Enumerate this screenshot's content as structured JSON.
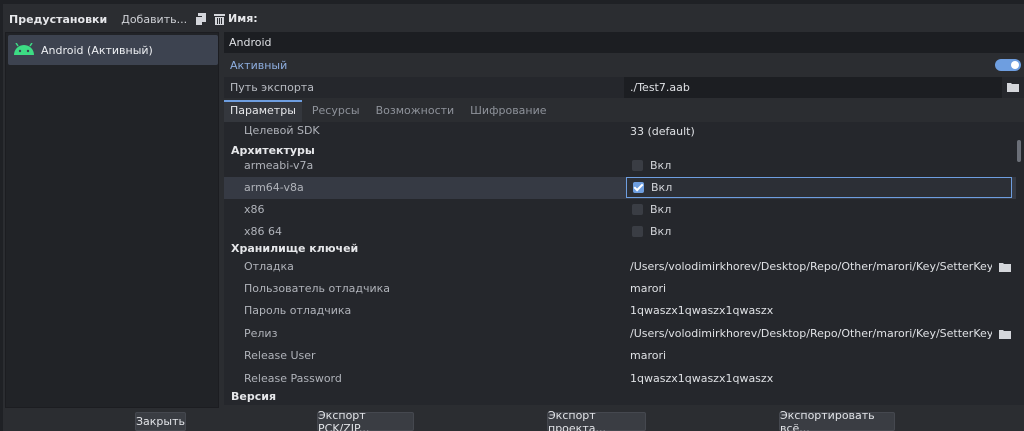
{
  "left_panel": {
    "title": "Предустановки",
    "add_label": "Добавить...",
    "presets": [
      {
        "label": "Android (Активный)",
        "icon": "android-icon"
      }
    ]
  },
  "header": {
    "name_label": "Имя:",
    "name_value": "Android",
    "active_label": "Активный",
    "active_on": true,
    "export_path_label": "Путь экспорта",
    "export_path_value": "./Test7.aab"
  },
  "tabs": [
    "Параметры",
    "Ресурсы",
    "Возможности",
    "Шифрование"
  ],
  "props": {
    "target_sdk_label": "Целевой SDK",
    "target_sdk_value": "33 (default)",
    "arch_section": "Архитектуры",
    "archs": [
      {
        "name": "armeabi-v7a",
        "value": "Вкл",
        "checked": false
      },
      {
        "name": "arm64-v8a",
        "value": "Вкл",
        "checked": true
      },
      {
        "name": "x86",
        "value": "Вкл",
        "checked": false
      },
      {
        "name": "x86 64",
        "value": "Вкл",
        "checked": false
      }
    ],
    "keystore_section": "Хранилище ключей",
    "keystore": [
      {
        "label": "Отладка",
        "value": "/Users/volodimirkhorev/Desktop/Repo/Other/marori/Key/SetterKey.keysto"
      },
      {
        "label": "Пользователь отладчика",
        "value": "marori"
      },
      {
        "label": "Пароль отладчика",
        "value": "1qwaszx1qwaszx1qwaszx"
      },
      {
        "label": "Релиз",
        "value": "/Users/volodimirkhorev/Desktop/Repo/Other/marori/Key/SetterKey.keysto"
      },
      {
        "label": "Release User",
        "value": "marori"
      },
      {
        "label": "Release Password",
        "value": "1qwaszx1qwaszx1qwaszx"
      }
    ],
    "version_section": "Версия"
  },
  "buttons": {
    "close": "Закрыть",
    "export_pck": "Экспорт PCK/ZIP...",
    "export_project": "Экспорт проекта...",
    "export_all": "Экспортировать всё..."
  },
  "colors": {
    "accent": "#6e9ee0",
    "android_green": "#3ddc84",
    "background": "#2b2d31"
  }
}
